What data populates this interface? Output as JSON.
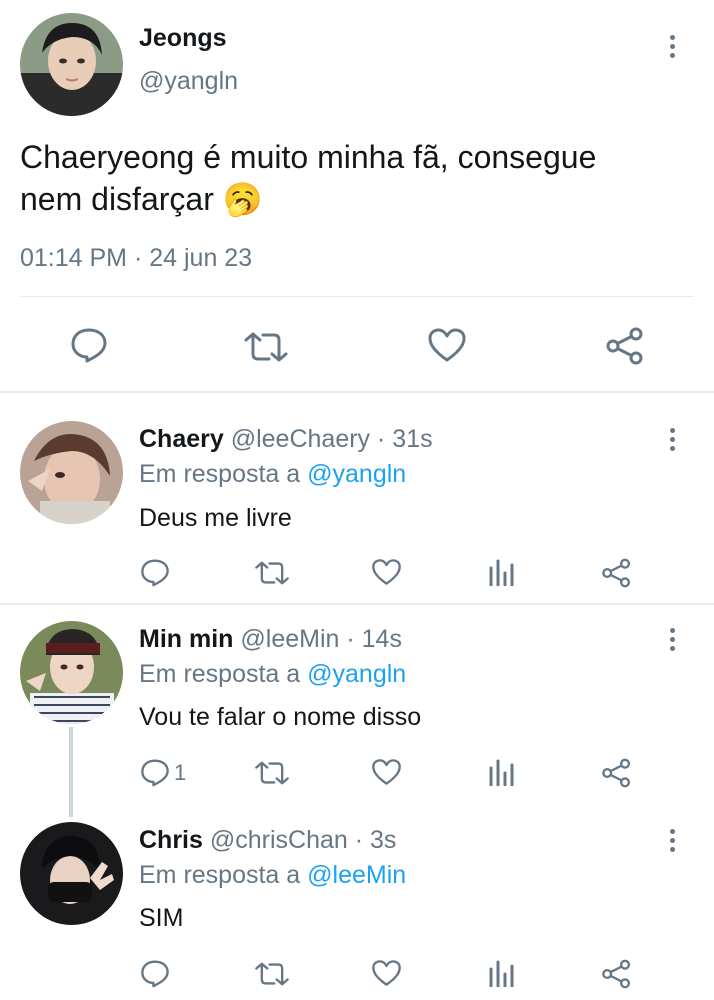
{
  "main_tweet": {
    "display_name": "Jeongs",
    "handle": "@yangln",
    "text_line1": "Chaeryeong é muito minha fã, consegue",
    "text_line2": "nem disfarçar",
    "emoji": "🥱",
    "time": "01:14 PM",
    "separator": "·",
    "date": "24 jun 23"
  },
  "replies": [
    {
      "display_name": "Chaery",
      "handle": "@leeChaery",
      "age": "· 31s",
      "reply_prefix": "Em resposta a",
      "reply_to": "@yangln",
      "text": "Deus me livre",
      "reply_count": ""
    },
    {
      "display_name": "Min min",
      "handle": "@leeMin",
      "age": "· 14s",
      "reply_prefix": "Em resposta a",
      "reply_to": "@yangln",
      "text": "Vou te falar o nome disso",
      "reply_count": "1"
    },
    {
      "display_name": "Chris",
      "handle": "@chrisChan",
      "age": "· 3s",
      "reply_prefix": "Em resposta a",
      "reply_to": "@leeMin",
      "text": "SIM",
      "reply_count": ""
    }
  ],
  "icons": {
    "reply": "speech-bubble-icon",
    "retweet": "retweet-icon",
    "like": "heart-icon",
    "analytics": "bar-chart-icon",
    "share": "share-icon",
    "more": "more-vertical-icon"
  },
  "colors": {
    "text": "#14171a",
    "secondary": "#657786",
    "link": "#1da1f2",
    "divider": "#e6ecf0"
  }
}
